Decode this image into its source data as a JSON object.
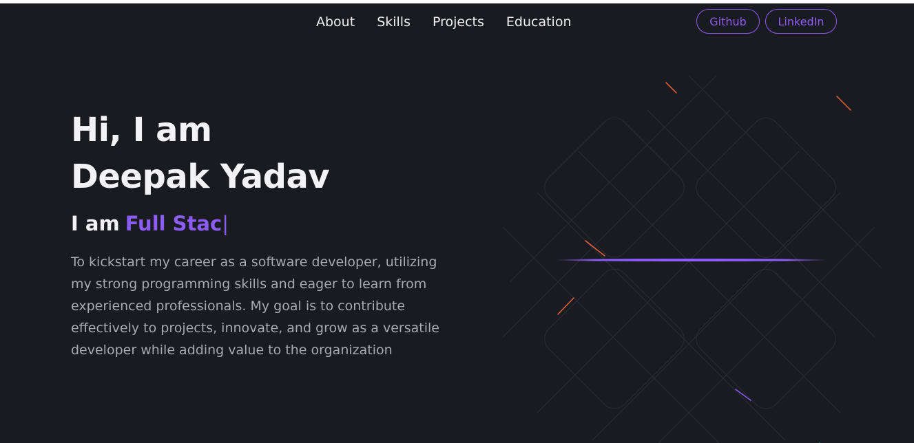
{
  "nav": {
    "links": [
      "About",
      "Skills",
      "Projects",
      "Education"
    ],
    "github": "Github",
    "linkedin": "LinkedIn"
  },
  "hero": {
    "line1": "Hi, I am",
    "line2": "Deepak Yadav",
    "role_prefix": "I am",
    "role_typed": "Full Stac",
    "cursor": "|",
    "bio": "To kickstart my career as a software developer, utilizing my strong programming skills and eager to learn from experienced professionals. My goal is to contribute effectively to projects, innovate, and grow as a versatile developer while adding value to the organization"
  },
  "colors": {
    "background": "#1a1a21",
    "accent": "#8b5cf6",
    "text": "#f3f3f5",
    "muted": "#a9a9b0",
    "spark": "#e8643a"
  }
}
